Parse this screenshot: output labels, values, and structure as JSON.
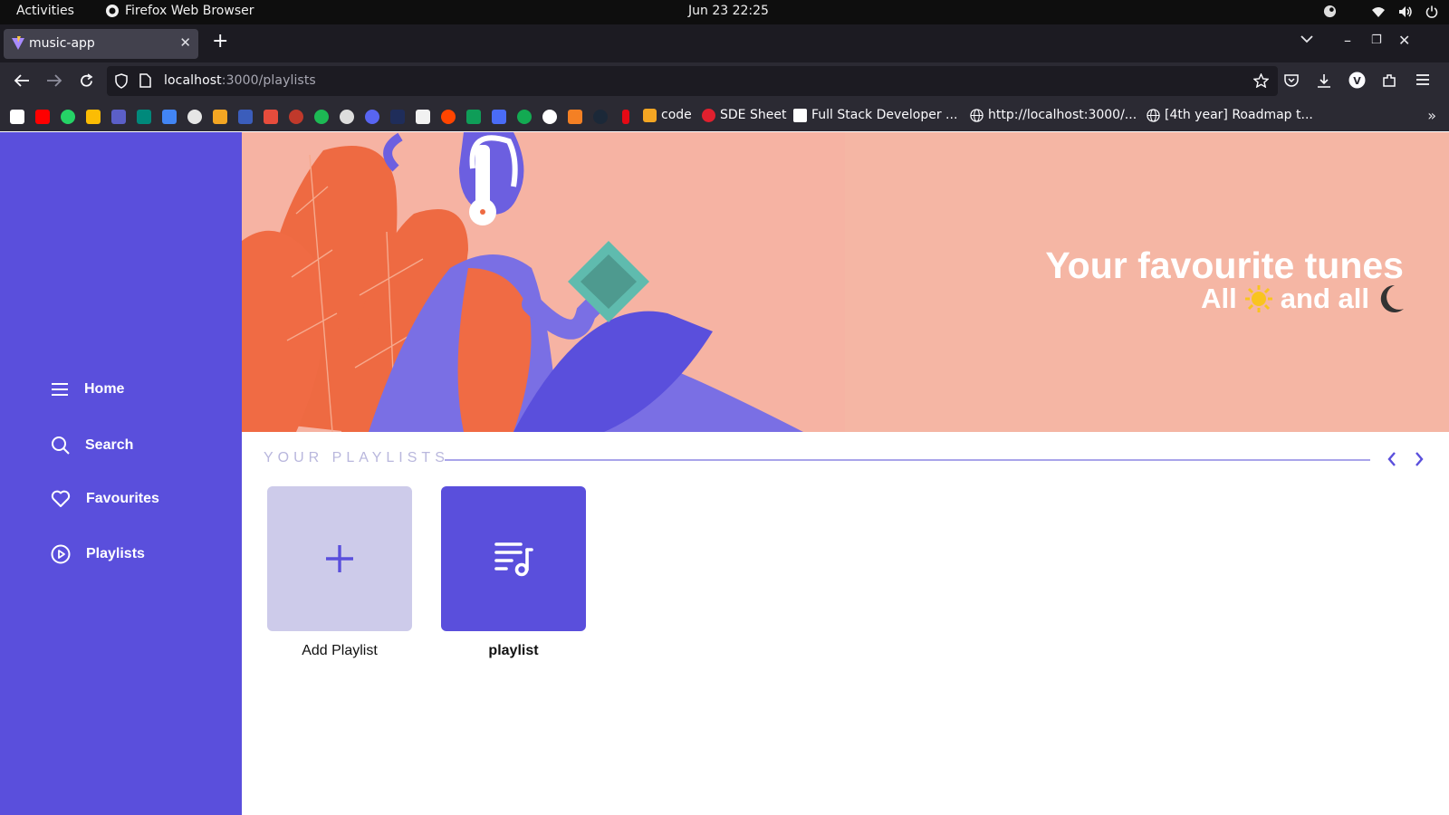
{
  "system_bar": {
    "activities": "Activities",
    "app_name": "Firefox Web Browser",
    "clock": "Jun 23  22:25"
  },
  "browser": {
    "tab_title": "music-app",
    "url_host": "localhost",
    "url_path": ":3000/playlists",
    "bookmarks": [
      {
        "label": "code"
      },
      {
        "label": "SDE Sheet"
      },
      {
        "label": "Full Stack Developer ..."
      },
      {
        "label": "http://localhost:3000/..."
      },
      {
        "label": "[4th year] Roadmap t..."
      }
    ]
  },
  "sidebar": {
    "items": [
      {
        "label": "Home",
        "icon": "menu-icon"
      },
      {
        "label": "Search",
        "icon": "search-icon"
      },
      {
        "label": "Favourites",
        "icon": "heart-icon"
      },
      {
        "label": "Playlists",
        "icon": "play-circle-icon"
      }
    ]
  },
  "banner": {
    "headline": "Your favourite tunes",
    "sub_left": "All",
    "sub_right": "and all"
  },
  "playlists": {
    "section_title": "YOUR PLAYLISTS",
    "cards": [
      {
        "label": "Add Playlist",
        "icon": "plus-icon"
      },
      {
        "label": "playlist",
        "icon": "playlist-music-icon"
      }
    ]
  },
  "colors": {
    "accent": "#5a4fdc",
    "banner_bg": "#f6b3a3",
    "add_card_bg": "#cdcbea"
  }
}
